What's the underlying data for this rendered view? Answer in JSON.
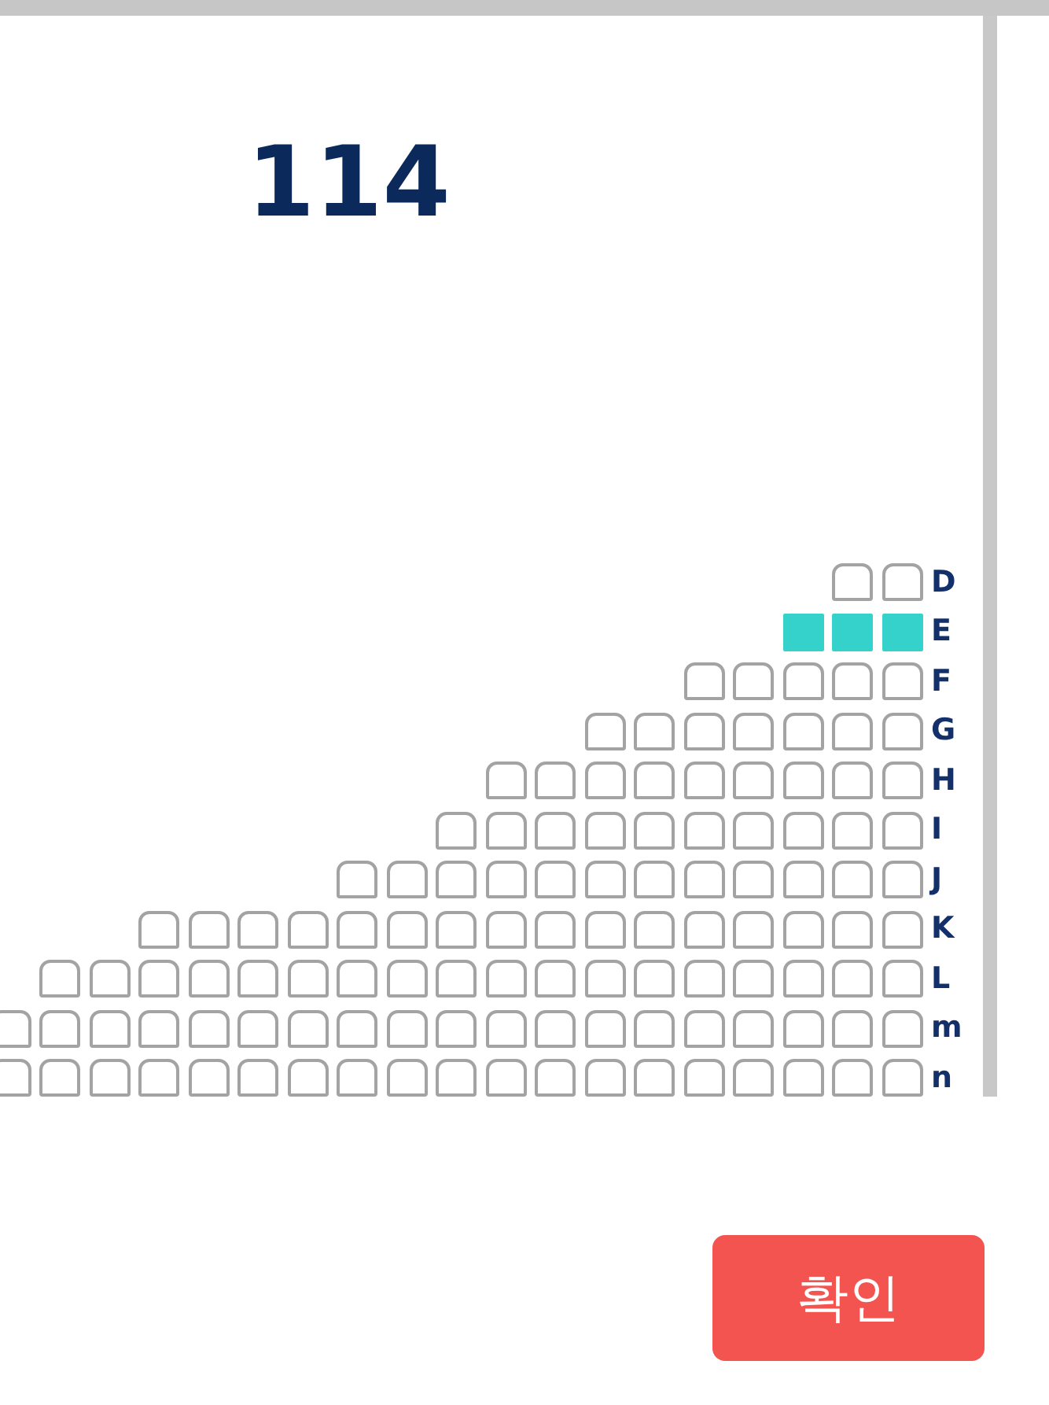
{
  "section_title": "114",
  "rows": [
    {
      "label": "D",
      "seats": [
        {
          "selected": false
        },
        {
          "selected": false
        }
      ]
    },
    {
      "label": "E",
      "seats": [
        {
          "selected": true
        },
        {
          "selected": true
        },
        {
          "selected": true
        }
      ]
    },
    {
      "label": "F",
      "seats": [
        {
          "selected": false
        },
        {
          "selected": false
        },
        {
          "selected": false
        },
        {
          "selected": false
        },
        {
          "selected": false
        }
      ]
    },
    {
      "label": "G",
      "seats": [
        {
          "selected": false
        },
        {
          "selected": false
        },
        {
          "selected": false
        },
        {
          "selected": false
        },
        {
          "selected": false
        },
        {
          "selected": false
        },
        {
          "selected": false
        }
      ]
    },
    {
      "label": "H",
      "seats": [
        {
          "selected": false
        },
        {
          "selected": false
        },
        {
          "selected": false
        },
        {
          "selected": false
        },
        {
          "selected": false
        },
        {
          "selected": false
        },
        {
          "selected": false
        },
        {
          "selected": false
        },
        {
          "selected": false
        }
      ]
    },
    {
      "label": "I",
      "seats": [
        {
          "selected": false
        },
        {
          "selected": false
        },
        {
          "selected": false
        },
        {
          "selected": false
        },
        {
          "selected": false
        },
        {
          "selected": false
        },
        {
          "selected": false
        },
        {
          "selected": false
        },
        {
          "selected": false
        },
        {
          "selected": false
        }
      ]
    },
    {
      "label": "J",
      "seats": [
        {
          "selected": false
        },
        {
          "selected": false
        },
        {
          "selected": false
        },
        {
          "selected": false
        },
        {
          "selected": false
        },
        {
          "selected": false
        },
        {
          "selected": false
        },
        {
          "selected": false
        },
        {
          "selected": false
        },
        {
          "selected": false
        },
        {
          "selected": false
        },
        {
          "selected": false
        }
      ]
    },
    {
      "label": "K",
      "seats": [
        {
          "selected": false
        },
        {
          "selected": false
        },
        {
          "selected": false
        },
        {
          "selected": false
        },
        {
          "selected": false
        },
        {
          "selected": false
        },
        {
          "selected": false
        },
        {
          "selected": false
        },
        {
          "selected": false
        },
        {
          "selected": false
        },
        {
          "selected": false
        },
        {
          "selected": false
        },
        {
          "selected": false
        },
        {
          "selected": false
        },
        {
          "selected": false
        },
        {
          "selected": false
        }
      ]
    },
    {
      "label": "L",
      "seats": [
        {
          "selected": false
        },
        {
          "selected": false
        },
        {
          "selected": false
        },
        {
          "selected": false
        },
        {
          "selected": false
        },
        {
          "selected": false
        },
        {
          "selected": false
        },
        {
          "selected": false
        },
        {
          "selected": false
        },
        {
          "selected": false
        },
        {
          "selected": false
        },
        {
          "selected": false
        },
        {
          "selected": false
        },
        {
          "selected": false
        },
        {
          "selected": false
        },
        {
          "selected": false
        },
        {
          "selected": false
        },
        {
          "selected": false
        }
      ]
    },
    {
      "label": "m",
      "seats": [
        {
          "selected": false
        },
        {
          "selected": false
        },
        {
          "selected": false
        },
        {
          "selected": false
        },
        {
          "selected": false
        },
        {
          "selected": false
        },
        {
          "selected": false
        },
        {
          "selected": false
        },
        {
          "selected": false
        },
        {
          "selected": false
        },
        {
          "selected": false
        },
        {
          "selected": false
        },
        {
          "selected": false
        },
        {
          "selected": false
        },
        {
          "selected": false
        },
        {
          "selected": false
        },
        {
          "selected": false
        },
        {
          "selected": false
        },
        {
          "selected": false
        }
      ]
    },
    {
      "label": "n",
      "seats": [
        {
          "selected": false
        },
        {
          "selected": false
        },
        {
          "selected": false
        },
        {
          "selected": false
        },
        {
          "selected": false
        },
        {
          "selected": false
        },
        {
          "selected": false
        },
        {
          "selected": false
        },
        {
          "selected": false
        },
        {
          "selected": false
        },
        {
          "selected": false
        },
        {
          "selected": false
        },
        {
          "selected": false
        },
        {
          "selected": false
        },
        {
          "selected": false
        },
        {
          "selected": false
        },
        {
          "selected": false
        },
        {
          "selected": false
        },
        {
          "selected": false
        }
      ]
    }
  ],
  "confirm_button": "확인"
}
